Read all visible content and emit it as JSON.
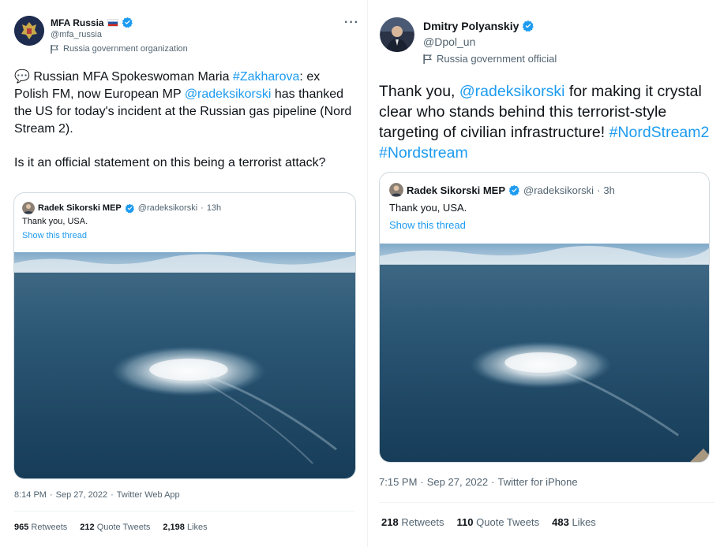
{
  "left": {
    "author_name": "MFA Russia",
    "author_handle": "@mfa_russia",
    "label": "Russia government organization",
    "more": "···",
    "speech_emoji": "💬",
    "text_p1_a": " Russian MFA Spokeswoman Maria ",
    "text_p1_hashtag": "#Zakharova",
    "text_p1_b": ": ex Polish FM, now European MP ",
    "text_p1_mention": "@radeksikorski",
    "text_p1_c": " has thanked the US for today's incident at the Russian gas pipeline (Nord Stream 2).",
    "text_p2": "Is it an official statement on this being a terrorist attack?",
    "quote": {
      "name": "Radek Sikorski MEP",
      "handle": "@radeksikorski",
      "sep": "·",
      "time": "13h",
      "text": "Thank you, USA.",
      "thread_link": "Show this thread"
    },
    "time": "8:14 PM",
    "date": "Sep 27, 2022",
    "app": "Twitter Web App",
    "retweets_count": "965",
    "retweets_label": "Retweets",
    "quotes_count": "212",
    "quotes_label": "Quote Tweets",
    "likes_count": "2,198",
    "likes_label": "Likes"
  },
  "right": {
    "author_name": "Dmitry Polyanskiy",
    "author_handle": "@Dpol_un",
    "label": "Russia government official",
    "text_a": "Thank you, ",
    "text_mention": "@radeksikorski",
    "text_b": " for making it crystal clear who stands behind this terrorist-style targeting of civilian infrastructure! ",
    "text_tag1": "#NordStream2",
    "text_space": " ",
    "text_tag2": "#Nordstream",
    "quote": {
      "name": "Radek Sikorski MEP",
      "handle": "@radeksikorski",
      "sep": "·",
      "time": "3h",
      "text": "Thank you, USA.",
      "thread_link": "Show this thread"
    },
    "time": "7:15 PM",
    "date": "Sep 27, 2022",
    "app": "Twitter for iPhone",
    "retweets_count": "218",
    "retweets_label": "Retweets",
    "quotes_count": "110",
    "quotes_label": "Quote Tweets",
    "likes_count": "483",
    "likes_label": "Likes"
  },
  "colors": {
    "link": "#1d9bf0",
    "verified": "#1d9bf0",
    "muted": "#536471",
    "text": "#0f1419",
    "sea": "#1f4a66"
  },
  "icons": {
    "verified": "verified-badge-icon",
    "flag": "russia-flag-icon",
    "label": "government-label-icon",
    "more": "more-options-icon",
    "speech": "speech-bubble-emoji"
  }
}
